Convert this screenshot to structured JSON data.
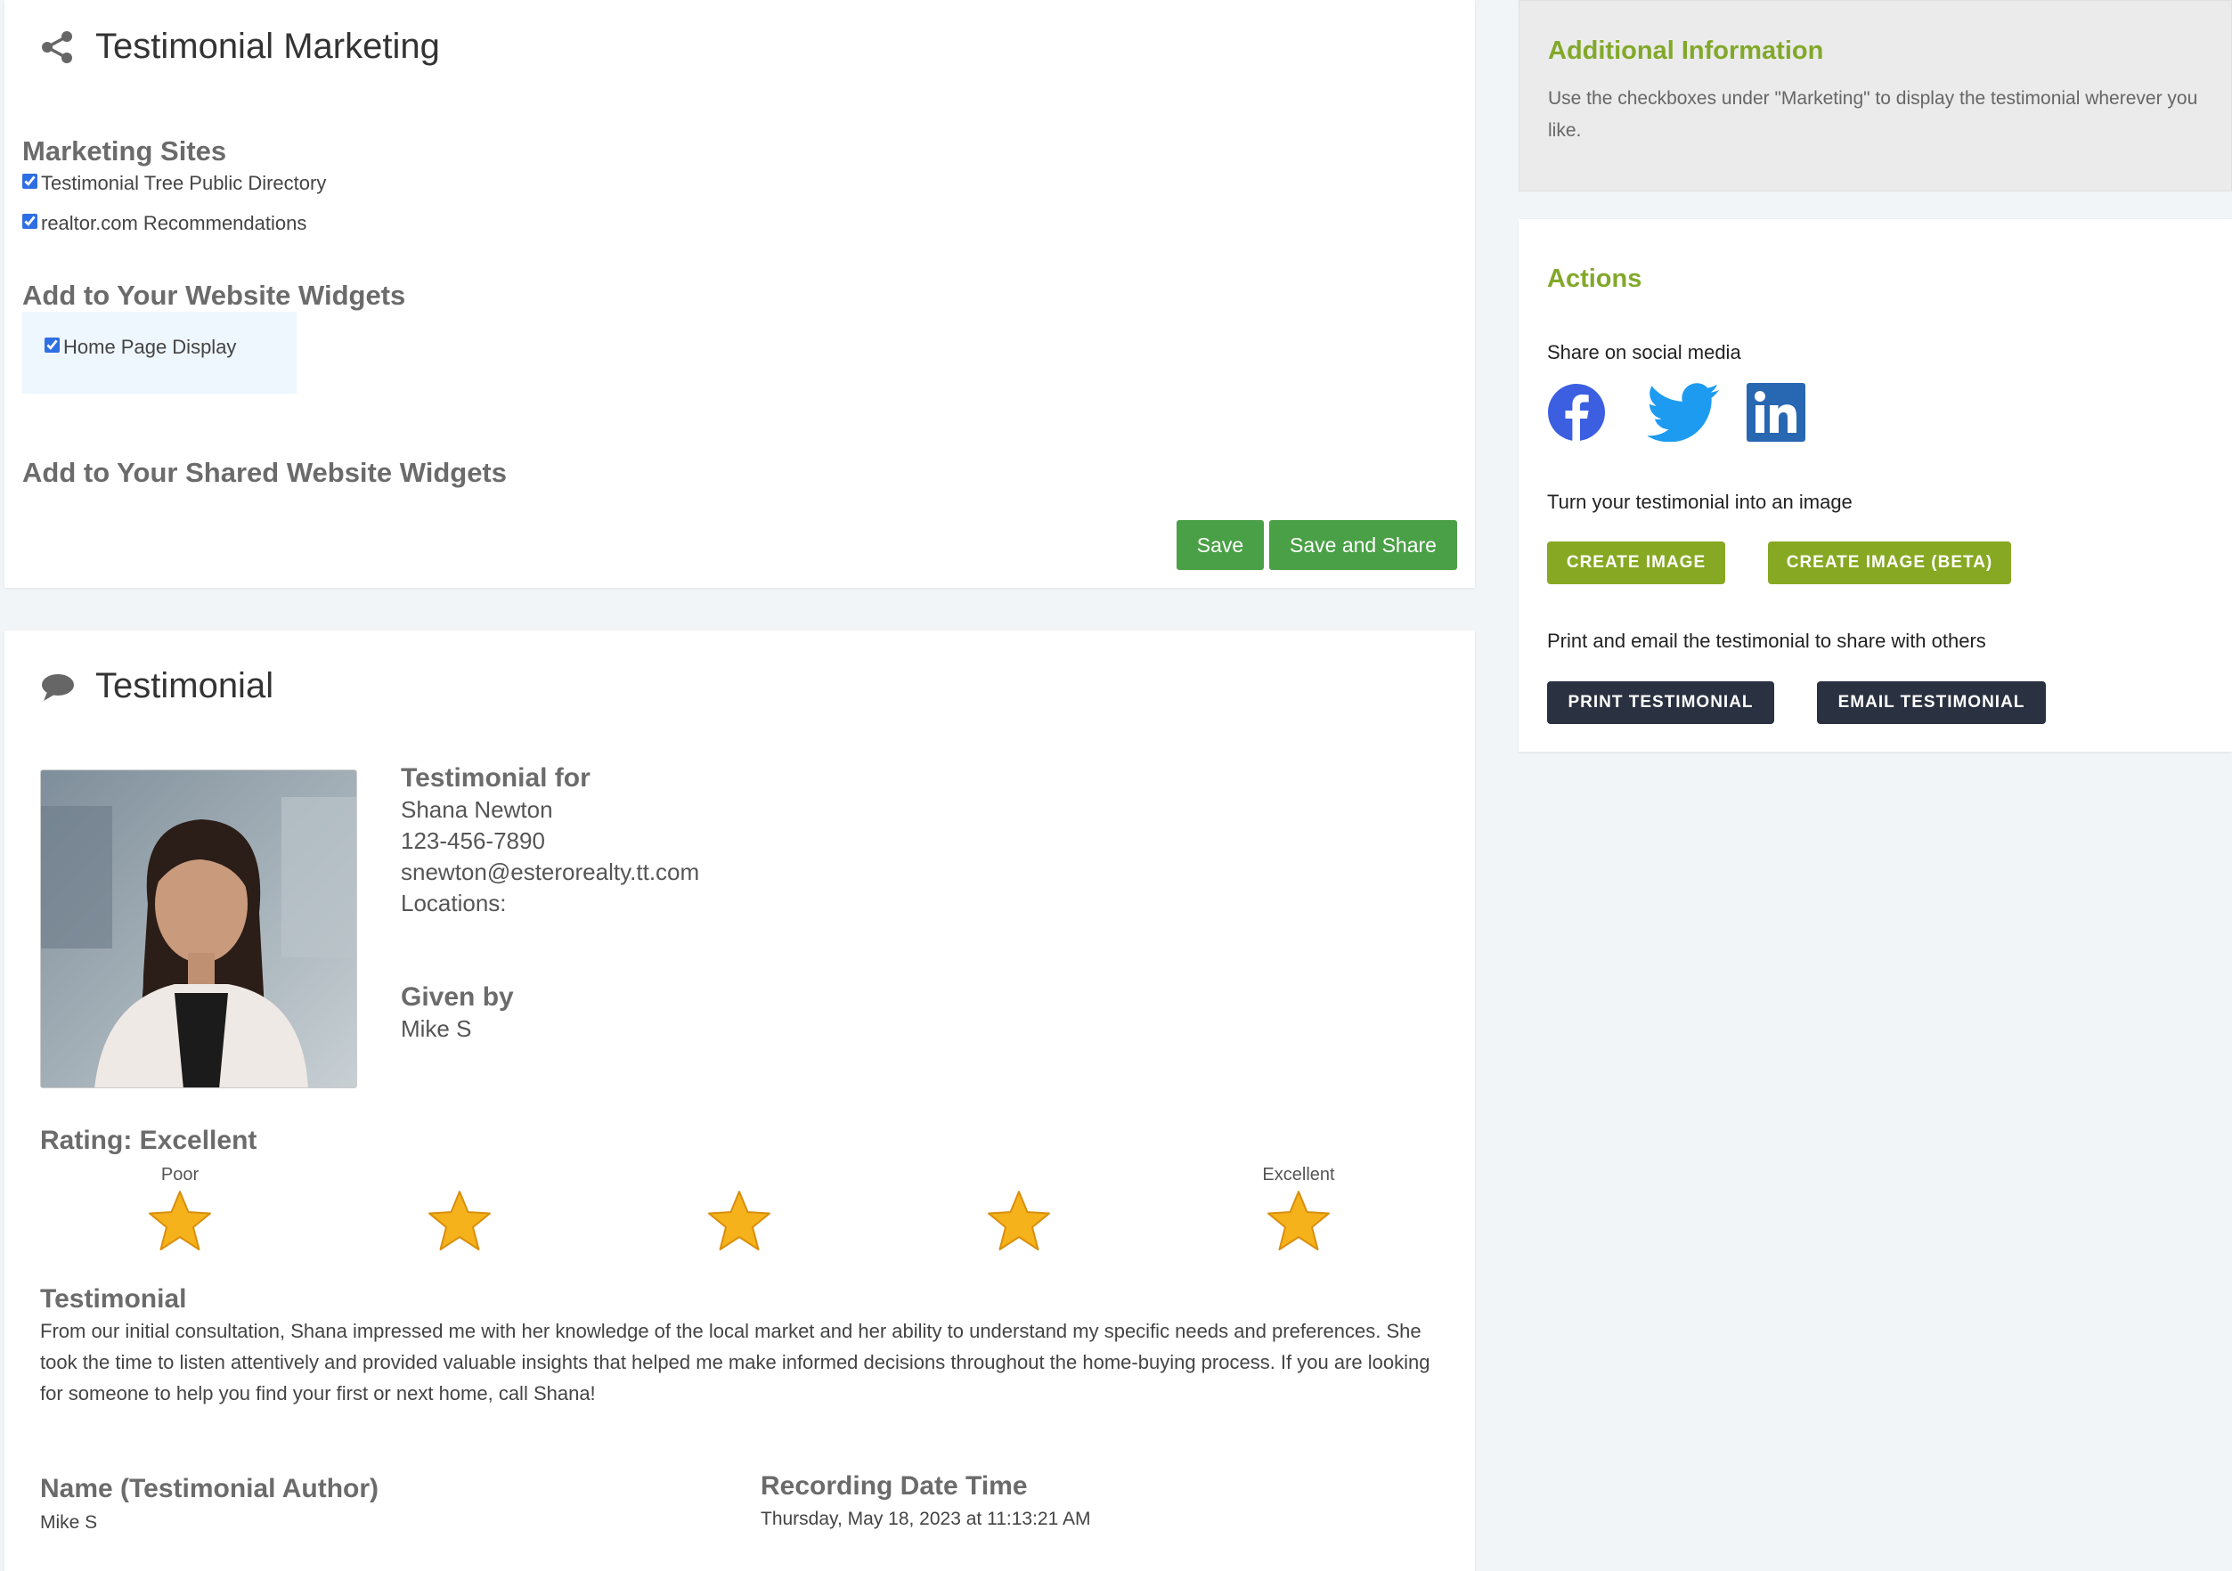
{
  "marketing": {
    "title": "Testimonial Marketing",
    "sites_heading": "Marketing Sites",
    "sites": [
      {
        "label": "Testimonial Tree Public Directory",
        "checked": true
      },
      {
        "label": "realtor.com Recommendations",
        "checked": true
      }
    ],
    "widgets_heading": "Add to Your Website Widgets",
    "widgets": [
      {
        "label": "Home Page Display",
        "checked": true
      }
    ],
    "shared_widgets_heading": "Add to Your Shared Website Widgets",
    "save_label": "Save",
    "save_share_label": "Save and Share"
  },
  "testimonial": {
    "title": "Testimonial",
    "for_heading": "Testimonial for",
    "agent_name": "Shana Newton",
    "agent_phone": "123-456-7890",
    "agent_email": "snewton@esterorealty.tt.com",
    "locations_label": "Locations:",
    "given_by_heading": "Given by",
    "given_by": "Mike S",
    "rating_title": "Rating: Excellent",
    "rating_value": 5,
    "rating_max": 5,
    "rating_low_label": "Poor",
    "rating_high_label": "Excellent",
    "body_heading": "Testimonial",
    "body": "From our initial consultation, Shana impressed me with her knowledge of the local market and her ability to understand my specific needs and preferences. She took the time to listen attentively and provided valuable insights that helped me make informed decisions throughout the home-buying process. If you are looking for someone to help you find your first or next home, call Shana!",
    "author_label": "Name (Testimonial Author)",
    "author_value": "Mike S",
    "date_label": "Recording Date Time",
    "date_value": "Thursday, May 18, 2023 at 11:13:21 AM"
  },
  "additional": {
    "title": "Additional Information",
    "text": "Use the checkboxes under \"Marketing\" to display the testimonial wherever you like."
  },
  "actions": {
    "title": "Actions",
    "share_label": "Share on social media",
    "social_icons": [
      "facebook-icon",
      "twitter-icon",
      "linkedin-icon"
    ],
    "image_label": "Turn your testimonial into an image",
    "create_image": "CREATE IMAGE",
    "create_image_beta": "CREATE IMAGE (BETA)",
    "print_label": "Print and email the testimonial to share with others",
    "print_button": "PRINT TESTIMONIAL",
    "email_button": "EMAIL TESTIMONIAL"
  },
  "colors": {
    "accent_green": "#4aa046",
    "olive": "#87a822",
    "dark_button": "#2a3140",
    "facebook": "#3b5fe0",
    "twitter": "#1d9bf0",
    "linkedin": "#2867b2",
    "star": "#f5b21b"
  }
}
